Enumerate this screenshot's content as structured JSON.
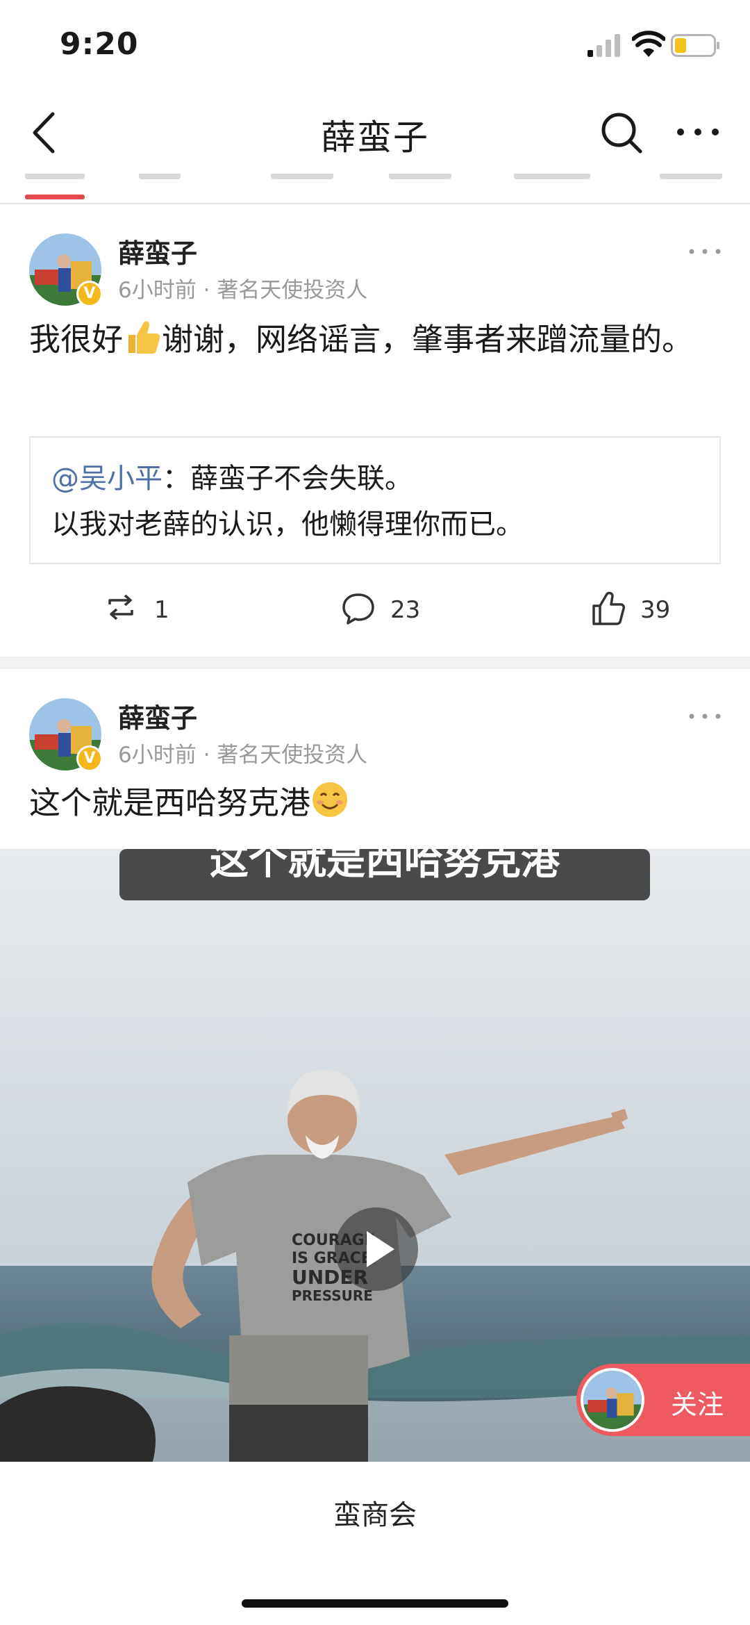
{
  "status_bar": {
    "time": "9:20"
  },
  "nav": {
    "title": "薛蛮子"
  },
  "posts": [
    {
      "author": "薛蛮子",
      "time": "6小时前",
      "separator": "·",
      "source": "著名天使投资人",
      "text_part1": "我很好",
      "text_part2": "谢谢，网络谣言，肇事者来蹭流量的。",
      "quote": {
        "mention": "@吴小平",
        "line1": "：薛蛮子不会失联。",
        "line2": "以我对老薛的认识，他懒得理你而已。"
      },
      "stats": {
        "reposts": "1",
        "comments": "23",
        "likes": "39"
      }
    },
    {
      "author": "薛蛮子",
      "time": "6小时前",
      "separator": "·",
      "source": "著名天使投资人",
      "text": "这个就是西哈努克港",
      "video": {
        "banner_text": "这个就是西哈努克港",
        "shirt_text": [
          "COURAGE",
          "IS GRACE",
          "UNDER",
          "PRESSURE"
        ]
      }
    }
  ],
  "follow_button": {
    "label": "关注"
  },
  "footer": {
    "label": "蛮商会"
  },
  "icons": {
    "back": "chevron-left-icon",
    "search": "search-icon",
    "more": "more-dots-icon",
    "repost": "repost-icon",
    "comment": "comment-icon",
    "like": "thumbs-up-icon",
    "play": "play-icon"
  },
  "colors": {
    "accent": "#e5484d",
    "mention": "#4f6fa5",
    "follow": "#ef5a5f",
    "verified": "#f5b81a"
  }
}
